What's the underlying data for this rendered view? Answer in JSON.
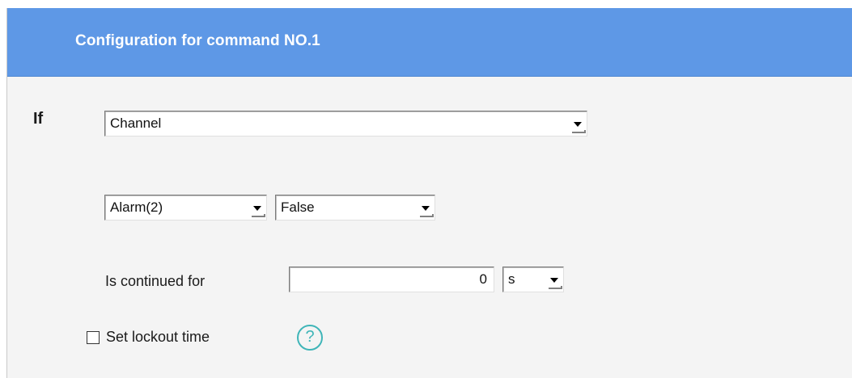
{
  "header": {
    "title": "Configuration for command NO.1"
  },
  "condition": {
    "if_label": "If",
    "source_select": "Channel",
    "alarm_select": "Alarm(2)",
    "state_select": "False"
  },
  "duration": {
    "label": "Is continued for",
    "value": "0",
    "unit_select": "s"
  },
  "lockout": {
    "label": "Set lockout time",
    "checked": false,
    "help_glyph": "?"
  },
  "colors": {
    "header_bg": "#5e98e6",
    "panel_bg": "#f4f4f4",
    "help_accent": "#3fb5b8"
  },
  "icons": {
    "help": "question-circle-icon",
    "dropdown": "chevron-down-icon"
  }
}
